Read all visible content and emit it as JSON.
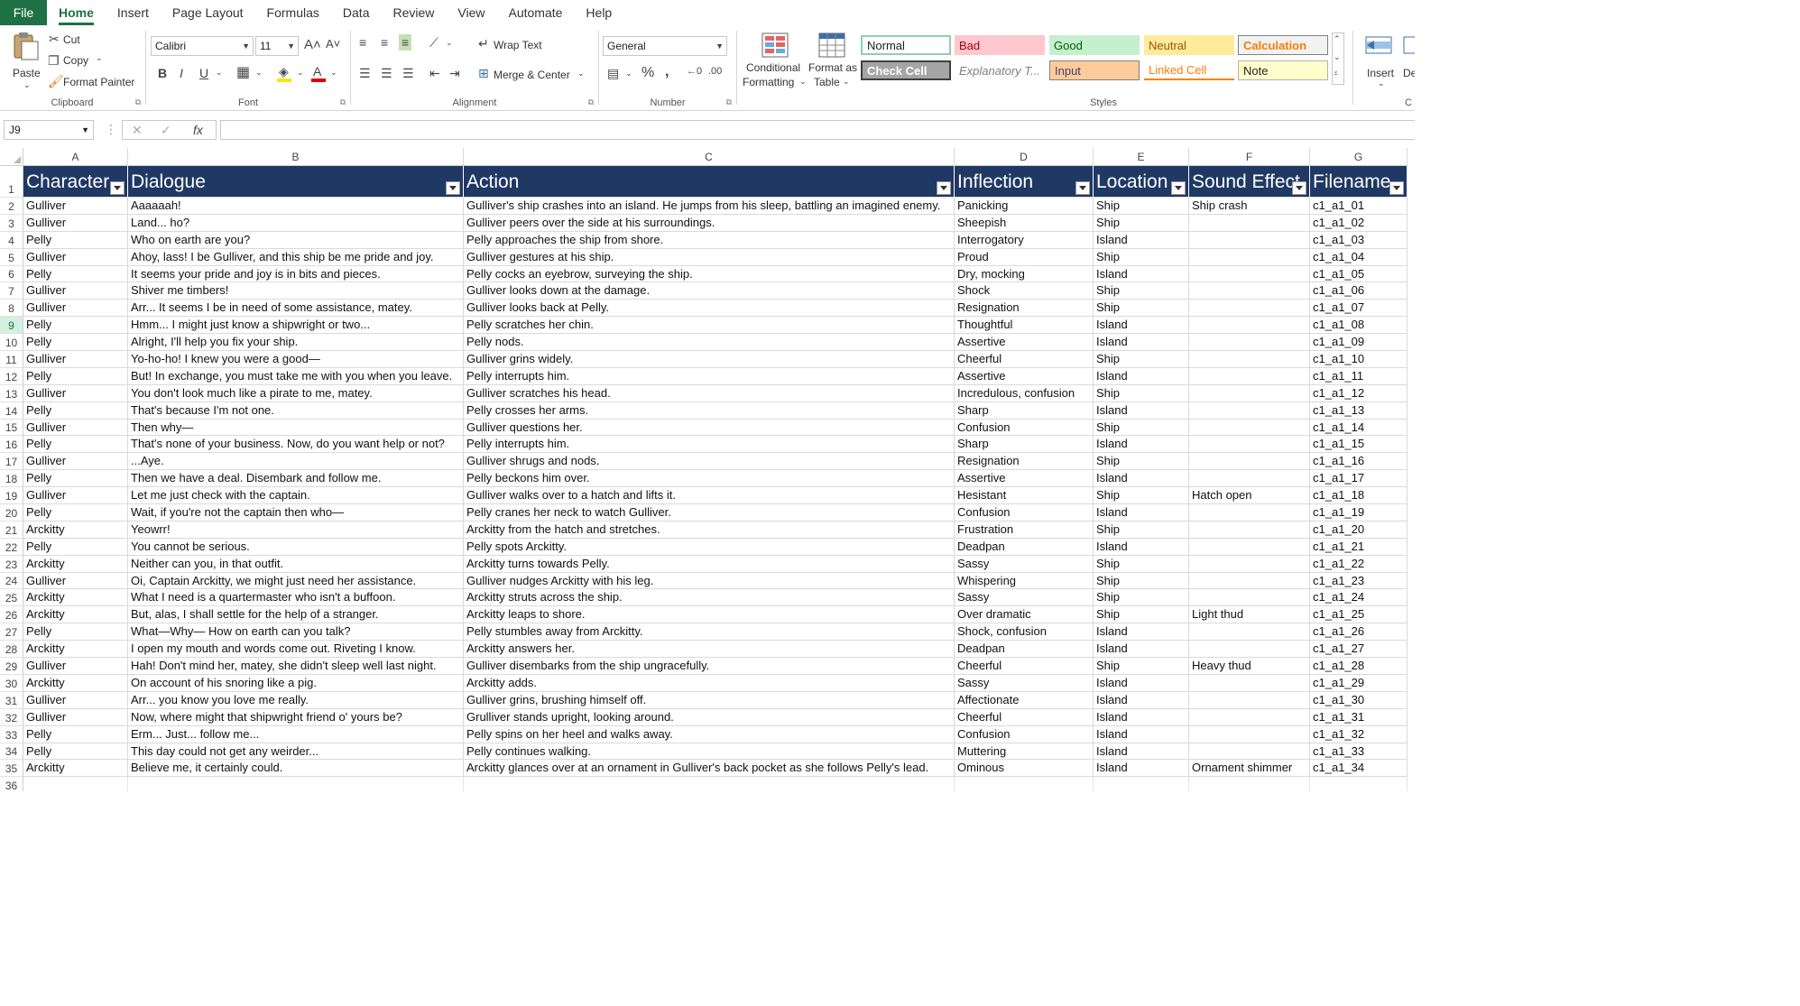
{
  "menu": {
    "file": "File",
    "tabs": [
      "Home",
      "Insert",
      "Page Layout",
      "Formulas",
      "Data",
      "Review",
      "View",
      "Automate",
      "Help"
    ]
  },
  "ribbon": {
    "clipboard": {
      "paste": "Paste",
      "cut": "Cut",
      "copy": "Copy",
      "format_painter": "Format Painter",
      "label": "Clipboard"
    },
    "font": {
      "name": "Calibri",
      "size": "11",
      "label": "Font"
    },
    "alignment": {
      "wrap_text": "Wrap Text",
      "merge_center": "Merge & Center",
      "label": "Alignment"
    },
    "number": {
      "format": "General",
      "label": "Number"
    },
    "styles": {
      "conditional_formatting_1": "Conditional",
      "conditional_formatting_2": "Formatting",
      "format_as_table_1": "Format as",
      "format_as_table_2": "Table",
      "label": "Styles",
      "gallery": [
        {
          "label": "Normal",
          "bg": "#ffffff",
          "fg": "#000000"
        },
        {
          "label": "Bad",
          "bg": "#ffc7ce",
          "fg": "#9c0006"
        },
        {
          "label": "Good",
          "bg": "#c6efce",
          "fg": "#006100"
        },
        {
          "label": "Neutral",
          "bg": "#ffeb9c",
          "fg": "#9c5700"
        },
        {
          "label": "Calculation",
          "bg": "#f2f2f2",
          "fg": "#fa7d00"
        },
        {
          "label": "Check Cell",
          "bg": "#a5a5a5",
          "fg": "#ffffff"
        },
        {
          "label": "Explanatory T...",
          "bg": "#ffffff",
          "fg": "#7f7f7f"
        },
        {
          "label": "Input",
          "bg": "#ffcc99",
          "fg": "#3f3f76"
        },
        {
          "label": "Linked Cell",
          "bg": "#ffffff",
          "fg": "#fa7d00"
        },
        {
          "label": "Note",
          "bg": "#ffffcc",
          "fg": "#000000"
        }
      ]
    },
    "cells": {
      "insert": "Insert",
      "delete": "De",
      "label": "C"
    }
  },
  "formula_bar": {
    "name_box": "J9",
    "fx": "fx",
    "value": ""
  },
  "columns": [
    "A",
    "B",
    "C",
    "D",
    "E",
    "F",
    "G"
  ],
  "header": [
    "Character",
    "Dialogue",
    "Action",
    "Inflection",
    "Location",
    "Sound Effect",
    "Filename"
  ],
  "rows": [
    [
      "Gulliver",
      "Aaaaaah!",
      "Gulliver's ship crashes into an island. He jumps from his sleep, battling an imagined enemy.",
      "Panicking",
      "Ship",
      "Ship crash",
      "c1_a1_01"
    ],
    [
      "Gulliver",
      "Land... ho?",
      "Gulliver peers over the side at his surroundings.",
      "Sheepish",
      "Ship",
      "",
      "c1_a1_02"
    ],
    [
      "Pelly",
      "Who on earth are you?",
      "Pelly approaches the ship from shore.",
      "Interrogatory",
      "Island",
      "",
      "c1_a1_03"
    ],
    [
      "Gulliver",
      "Ahoy, lass! I be Gulliver, and this ship be me pride and joy.",
      "Gulliver gestures at his ship.",
      "Proud",
      "Ship",
      "",
      "c1_a1_04"
    ],
    [
      "Pelly",
      "It seems your pride and joy is in bits and pieces.",
      "Pelly cocks an eyebrow, surveying the ship.",
      "Dry, mocking",
      "Island",
      "",
      "c1_a1_05"
    ],
    [
      "Gulliver",
      "Shiver me timbers!",
      "Gulliver looks down at the damage.",
      "Shock",
      "Ship",
      "",
      "c1_a1_06"
    ],
    [
      "Gulliver",
      "Arr... It seems I be in need of some assistance, matey.",
      "Gulliver looks back at Pelly.",
      "Resignation",
      "Ship",
      "",
      "c1_a1_07"
    ],
    [
      "Pelly",
      "Hmm... I might just know a shipwright or two...",
      "Pelly scratches her chin.",
      "Thoughtful",
      "Island",
      "",
      "c1_a1_08"
    ],
    [
      "Pelly",
      "Alright, I'll help you fix your ship.",
      "Pelly nods.",
      "Assertive",
      "Island",
      "",
      "c1_a1_09"
    ],
    [
      "Gulliver",
      "Yo-ho-ho! I knew you were a good—",
      "Gulliver grins widely.",
      "Cheerful",
      "Ship",
      "",
      "c1_a1_10"
    ],
    [
      "Pelly",
      "But! In exchange, you must take me with you when you leave.",
      "Pelly interrupts him.",
      "Assertive",
      "Island",
      "",
      "c1_a1_11"
    ],
    [
      "Gulliver",
      "You don't look much like a pirate to me, matey.",
      "Gulliver scratches his head.",
      "Incredulous, confusion",
      "Ship",
      "",
      "c1_a1_12"
    ],
    [
      "Pelly",
      "That's because I'm not one.",
      "Pelly crosses her arms.",
      "Sharp",
      "Island",
      "",
      "c1_a1_13"
    ],
    [
      "Gulliver",
      "Then why—",
      "Gulliver questions her.",
      "Confusion",
      "Ship",
      "",
      "c1_a1_14"
    ],
    [
      "Pelly",
      "That's none of your business. Now, do you want help or not?",
      "Pelly interrupts him.",
      "Sharp",
      "Island",
      "",
      "c1_a1_15"
    ],
    [
      "Gulliver",
      "...Aye.",
      "Gulliver shrugs and nods.",
      "Resignation",
      "Ship",
      "",
      "c1_a1_16"
    ],
    [
      "Pelly",
      "Then we have a deal. Disembark and follow me.",
      "Pelly beckons him over.",
      "Assertive",
      "Island",
      "",
      "c1_a1_17"
    ],
    [
      "Gulliver",
      "Let me just check with the captain.",
      "Gulliver walks over to a hatch and lifts it.",
      "Hesistant",
      "Ship",
      "Hatch open",
      "c1_a1_18"
    ],
    [
      "Pelly",
      "Wait, if you're not the captain then who—",
      "Pelly cranes her neck to watch Gulliver.",
      "Confusion",
      "Island",
      "",
      "c1_a1_19"
    ],
    [
      "Arckitty",
      "Yeowrr!",
      "Arckitty from the hatch and stretches.",
      "Frustration",
      "Ship",
      "",
      "c1_a1_20"
    ],
    [
      "Pelly",
      "You cannot be serious.",
      "Pelly spots Arckitty.",
      "Deadpan",
      "Island",
      "",
      "c1_a1_21"
    ],
    [
      "Arckitty",
      "Neither can you, in that outfit.",
      "Arckitty turns towards Pelly.",
      "Sassy",
      "Ship",
      "",
      "c1_a1_22"
    ],
    [
      "Gulliver",
      "Oi, Captain Arckitty, we might just need her assistance.",
      "Gulliver nudges Arckitty with his leg.",
      "Whispering",
      "Ship",
      "",
      "c1_a1_23"
    ],
    [
      "Arckitty",
      "What I need is a quartermaster who isn't a buffoon.",
      "Arckitty struts across the ship.",
      "Sassy",
      "Ship",
      "",
      "c1_a1_24"
    ],
    [
      "Arckitty",
      "But, alas, I shall settle for the help of a stranger.",
      "Arckitty leaps to shore.",
      "Over dramatic",
      "Ship",
      "Light thud",
      "c1_a1_25"
    ],
    [
      "Pelly",
      "What—Why— How on earth can you talk?",
      "Pelly stumbles away from Arckitty.",
      "Shock, confusion",
      "Island",
      "",
      "c1_a1_26"
    ],
    [
      "Arckitty",
      "I open my mouth and words come out. Riveting I know.",
      "Arckitty answers her.",
      "Deadpan",
      "Island",
      "",
      "c1_a1_27"
    ],
    [
      "Gulliver",
      "Hah! Don't mind her, matey, she didn't sleep well last night.",
      "Gulliver disembarks from the ship ungracefully.",
      "Cheerful",
      "Ship",
      "Heavy thud",
      "c1_a1_28"
    ],
    [
      "Arckitty",
      "On account of his snoring like a pig.",
      "Arckitty adds.",
      "Sassy",
      "Island",
      "",
      "c1_a1_29"
    ],
    [
      "Gulliver",
      "Arr... you know you love me really.",
      "Gulliver grins, brushing himself off.",
      "Affectionate",
      "Island",
      "",
      "c1_a1_30"
    ],
    [
      "Gulliver",
      "Now, where might that shipwright friend o' yours be?",
      "Grulliver stands upright, looking around.",
      "Cheerful",
      "Island",
      "",
      "c1_a1_31"
    ],
    [
      "Pelly",
      "Erm... Just... follow me...",
      "Pelly spins on her heel and walks away.",
      "Confusion",
      "Island",
      "",
      "c1_a1_32"
    ],
    [
      "Pelly",
      "This day could not get any weirder...",
      "Pelly continues walking.",
      "Muttering",
      "Island",
      "",
      "c1_a1_33"
    ],
    [
      "Arckitty",
      "Believe me, it certainly could.",
      "Arckitty glances over at an ornament in Gulliver's back pocket as she follows Pelly's lead.",
      "Ominous",
      "Island",
      "Ornament shimmer",
      "c1_a1_34"
    ]
  ],
  "row_numbers": [
    "1",
    "2",
    "3",
    "4",
    "5",
    "6",
    "7",
    "8",
    "9",
    "10",
    "11",
    "12",
    "13",
    "14",
    "15",
    "16",
    "17",
    "18",
    "19",
    "20",
    "21",
    "22",
    "23",
    "24",
    "25",
    "26",
    "27",
    "28",
    "29",
    "30",
    "31",
    "32",
    "33",
    "34",
    "35",
    "36"
  ],
  "selected_row": "9",
  "colors": {
    "excel_green": "#1e7145",
    "header_fill": "#1f3864",
    "header_text": "#ffffff"
  }
}
